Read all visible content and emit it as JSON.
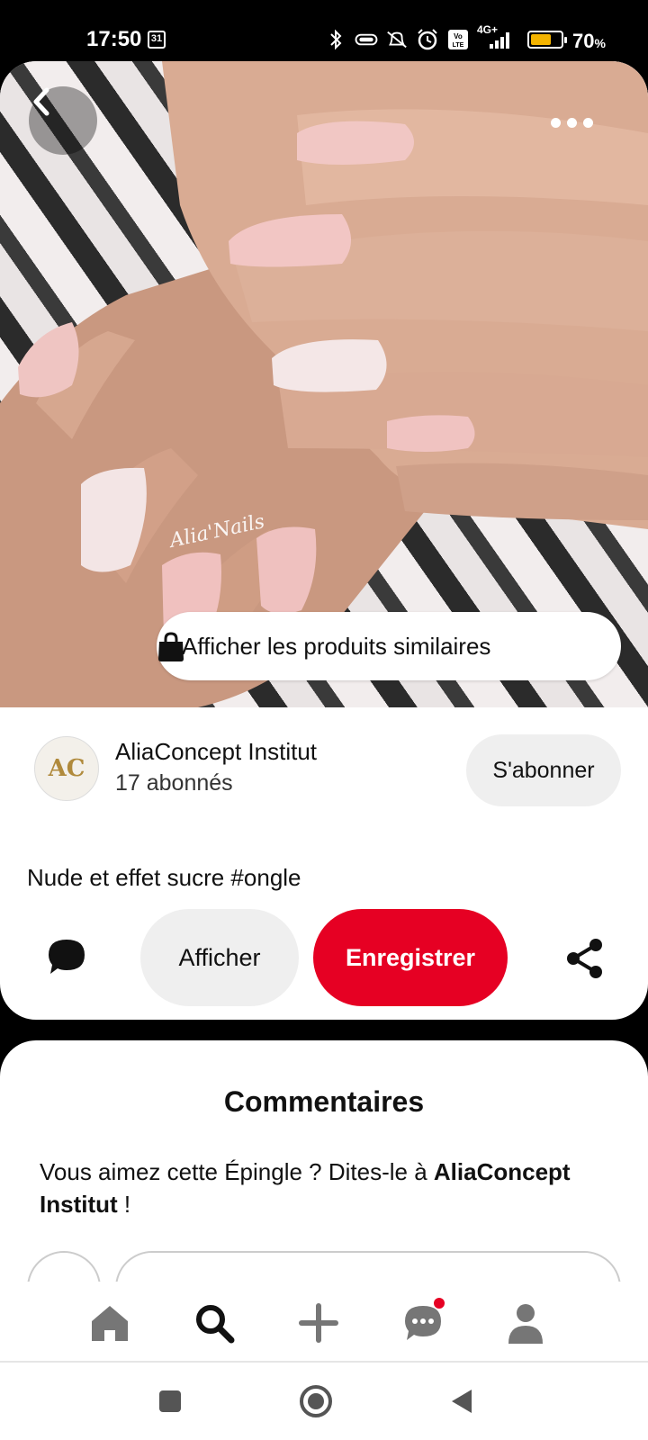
{
  "status_bar": {
    "time": "17:50",
    "calendar_day": "31",
    "network": "4G+",
    "battery_percent": "70",
    "battery_unit": "%",
    "battery_level": 0.7,
    "icons": [
      "bluetooth-icon",
      "vpn-icon",
      "mute-icon",
      "alarm-icon",
      "volte-icon",
      "signal-icon",
      "battery-icon"
    ]
  },
  "pin": {
    "watermark": "Alia'Nails",
    "similar_products_label": "Afficher les produits similaires",
    "description": "Nude et effet sucre #ongle"
  },
  "creator": {
    "avatar_text": "AC",
    "name": "AliaConcept Institut",
    "followers": "17 abonnés",
    "follow_label": "S'abonner"
  },
  "actions": {
    "show_label": "Afficher",
    "save_label": "Enregistrer"
  },
  "comments": {
    "title": "Commentaires",
    "prompt_text": "Vous aimez cette Épingle ? Dites-le à ",
    "prompt_name": "AliaConcept Institut",
    "prompt_end": " !"
  },
  "bottom_nav": {
    "items": [
      "home-icon",
      "search-icon",
      "add-icon",
      "messages-icon",
      "profile-icon"
    ],
    "active": "search-icon"
  },
  "colors": {
    "accent": "#e60023",
    "button_bg": "#efefef",
    "text": "#111111"
  }
}
